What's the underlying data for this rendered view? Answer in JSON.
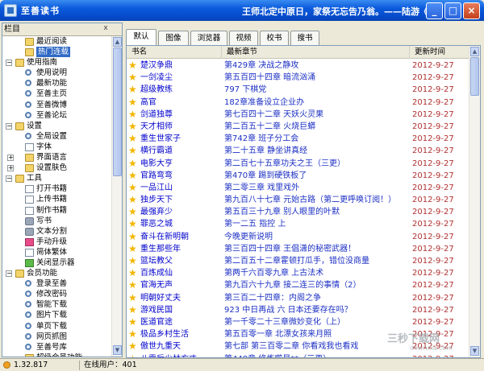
{
  "window": {
    "title": "至善读书",
    "marquee": "王师北定中原日，家祭无忘告乃翁。——陆游《...",
    "minimize": "_",
    "maximize": "□",
    "close": "×"
  },
  "sidebar": {
    "header": "栏目",
    "close": "x",
    "items": [
      {
        "label": "最近阅读",
        "level": 1,
        "icon": "folder-icon"
      },
      {
        "label": "热门连载",
        "level": 1,
        "icon": "folder-icon",
        "selected": true
      },
      {
        "label": "使用指南",
        "level": 0,
        "icon": "folder-icon",
        "expanded": true
      },
      {
        "label": "使用说明",
        "level": 1,
        "icon": "magnifier-icon"
      },
      {
        "label": "最新功能",
        "level": 1,
        "icon": "magnifier-icon"
      },
      {
        "label": "至善主页",
        "level": 1,
        "icon": "magnifier-icon"
      },
      {
        "label": "至善微博",
        "level": 1,
        "icon": "magnifier-icon"
      },
      {
        "label": "至善论坛",
        "level": 1,
        "icon": "magnifier-icon"
      },
      {
        "label": "设置",
        "level": 0,
        "icon": "folder-icon",
        "expanded": true
      },
      {
        "label": "全局设置",
        "level": 1,
        "icon": "magnifier-icon"
      },
      {
        "label": "字体",
        "level": 1,
        "icon": "page-icon"
      },
      {
        "label": "界面语言",
        "level": 1,
        "icon": "folder-icon",
        "expandable": true
      },
      {
        "label": "设置肤色",
        "level": 1,
        "icon": "folder-icon",
        "expandable": true
      },
      {
        "label": "工具",
        "level": 0,
        "icon": "folder-icon",
        "expanded": true
      },
      {
        "label": "打开书籍",
        "level": 1,
        "icon": "page-icon"
      },
      {
        "label": "上传书籍",
        "level": 1,
        "icon": "page-icon"
      },
      {
        "label": "制作书籍",
        "level": 1,
        "icon": "page-icon"
      },
      {
        "label": "写书",
        "level": 1,
        "icon": "tool-icon"
      },
      {
        "label": "文本分割",
        "level": 1,
        "icon": "tool-icon"
      },
      {
        "label": "手动升级",
        "level": 1,
        "icon": "pink-icon"
      },
      {
        "label": "简体繁体",
        "level": 1,
        "icon": "page-icon"
      },
      {
        "label": "关闭显示器",
        "level": 1,
        "icon": "green-icon"
      },
      {
        "label": "会员功能",
        "level": 0,
        "icon": "folder-icon",
        "expanded": true
      },
      {
        "label": "登录至善",
        "level": 1,
        "icon": "magnifier-icon"
      },
      {
        "label": "修改密码",
        "level": 1,
        "icon": "magnifier-icon"
      },
      {
        "label": "智能下载",
        "level": 1,
        "icon": "magnifier-icon"
      },
      {
        "label": "图片下载",
        "level": 1,
        "icon": "magnifier-icon"
      },
      {
        "label": "单页下载",
        "level": 1,
        "icon": "magnifier-icon"
      },
      {
        "label": "网页抓图",
        "level": 1,
        "icon": "magnifier-icon"
      },
      {
        "label": "至善号库",
        "level": 1,
        "icon": "magnifier-icon"
      },
      {
        "label": "超级会员功能",
        "level": 1,
        "icon": "folder-icon",
        "expanded": true
      },
      {
        "label": "在声书库",
        "level": 2,
        "icon": "folder-icon"
      }
    ]
  },
  "tabs": [
    "默认",
    "图像",
    "浏览器",
    "视频",
    "校书",
    "搜书"
  ],
  "table": {
    "headers": [
      "书名",
      "最新章节",
      "更新时间"
    ],
    "rows": [
      {
        "name": "楚汉争鼎",
        "chapter": "第429章 决战之静攻",
        "time": "2012-9-27"
      },
      {
        "name": "一剑凌尘",
        "chapter": "第五百四十四章 暗流汹涌",
        "time": "2012-9-27"
      },
      {
        "name": "超级教练",
        "chapter": "797 下棋党",
        "time": "2012-9-27"
      },
      {
        "name": "高官",
        "chapter": "182章准备设立企业办",
        "time": "2012-9-27"
      },
      {
        "name": "剑道独尊",
        "chapter": "第七百四十二章 天妖火灵果",
        "time": "2012-9-27"
      },
      {
        "name": "天才相师",
        "chapter": "第二百五十二章 火烧巨蟒",
        "time": "2012-9-27"
      },
      {
        "name": "重生世家子",
        "chapter": "第742章 班子分工会",
        "time": "2012-9-27"
      },
      {
        "name": "横行霸道",
        "chapter": "第二十五章 静坐讲真经",
        "time": "2012-9-27"
      },
      {
        "name": "电影大亨",
        "chapter": "第二百七十五章功夫之王（三更）",
        "time": "2012-9-27"
      },
      {
        "name": "官路弯弯",
        "chapter": "第470章 踢到硬铁板了",
        "time": "2012-9-27"
      },
      {
        "name": "一品江山",
        "chapter": "第二零三章 戏里戏外",
        "time": "2012-9-27"
      },
      {
        "name": "独步天下",
        "chapter": "第九百八十七章 元始古路（第二更呼唤订阅！）",
        "time": "2012-9-27"
      },
      {
        "name": "最强弃少",
        "chapter": "第五百三十九章 别人眼里的叶默",
        "time": "2012-9-27"
      },
      {
        "name": "罪恶之城",
        "chapter": "第一二五 指控 上",
        "time": "2012-9-27"
      },
      {
        "name": "奋斗在新明朝",
        "chapter": "今晚更新说明",
        "time": "2012-9-27"
      },
      {
        "name": "重生那些年",
        "chapter": "第三百四十四章 王倡潇的秘密武器！",
        "time": "2012-9-27"
      },
      {
        "name": "篮坛教父",
        "chapter": "第二百五十二章霍顿打瓜手，错位没商量",
        "time": "2012-9-27"
      },
      {
        "name": "百炼成仙",
        "chapter": "第两千六百零九章 上古法术",
        "time": "2012-9-27"
      },
      {
        "name": "官海无声",
        "chapter": "第九百六十九章 接二连三的事情（2）",
        "time": "2012-9-27"
      },
      {
        "name": "明朝好丈夫",
        "chapter": "第三百二十四章：内阁之争",
        "time": "2012-9-27"
      },
      {
        "name": "游戏民国",
        "chapter": "923 中日再战 六 日本还要存在吗？",
        "time": "2012-9-27"
      },
      {
        "name": "医道官途",
        "chapter": "第一千零二十三章微妙变化（上）",
        "time": "2012-9-27"
      },
      {
        "name": "极品乡村生活",
        "chapter": "第五百零一章 北漂女孩来月照",
        "time": "2012-9-27"
      },
      {
        "name": "傲世九重天",
        "chapter": "第七部 第三百零二章 你看戏我也看戏",
        "time": "2012-9-27"
      },
      {
        "name": "八零后少林方丈",
        "chapter": "第448章 修炼噬星**（三更）",
        "time": "2012-9-27"
      },
      {
        "name": "无尽神功",
        "chapter": "第二百九十九章 来多少，我杀多少！",
        "time": "2012-9-27"
      },
      {
        "name": "杀神",
        "chapter": "第一千二百二十五章 四海商会",
        "time": "2012-9-27"
      }
    ]
  },
  "status": {
    "version": "1.32.817",
    "online": "在线用户：401"
  },
  "watermark": {
    "brand": "三秒下载网",
    "url": "downxia.com"
  }
}
